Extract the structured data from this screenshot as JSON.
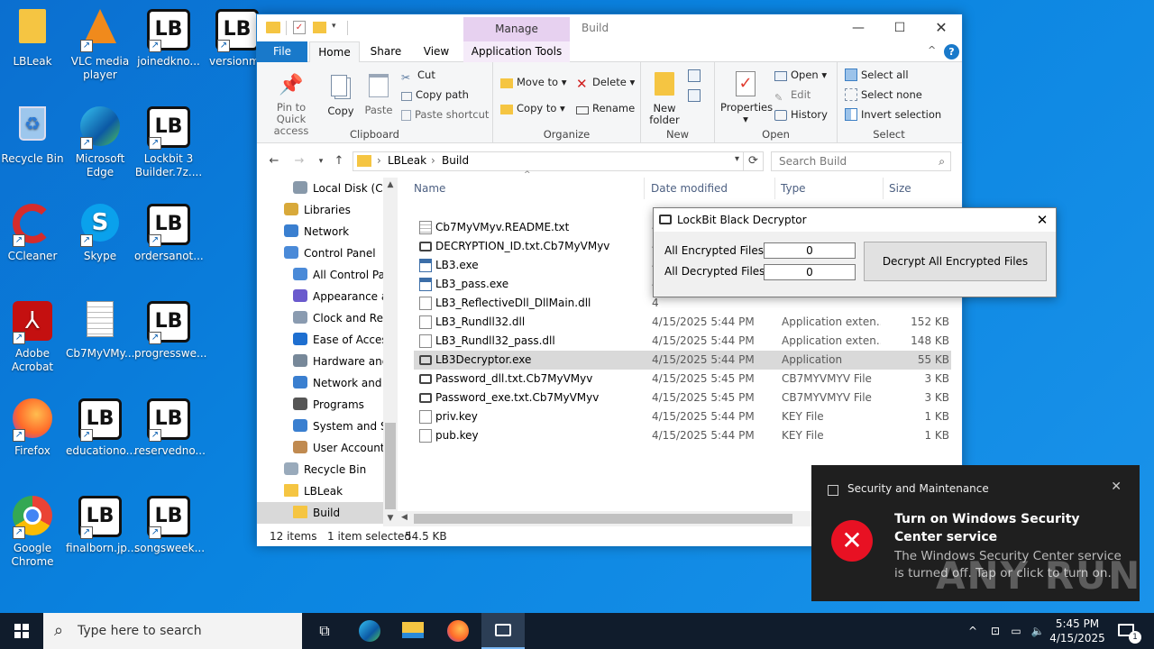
{
  "desktop": {
    "icons": [
      {
        "label": "LBLeak",
        "icon": "folder-icon"
      },
      {
        "label": "VLC media player",
        "icon": "vlc-icon"
      },
      {
        "label": "joinedkno...",
        "icon": "lockbit-icon"
      },
      {
        "label": "versionms",
        "icon": "lockbit-icon"
      },
      {
        "label": "Recycle Bin",
        "icon": "recycle-bin-icon"
      },
      {
        "label": "Microsoft Edge",
        "icon": "edge-icon"
      },
      {
        "label": "Lockbit 3 Builder.7z....",
        "icon": "lockbit-icon"
      },
      {
        "label": "CCleaner",
        "icon": "ccleaner-icon"
      },
      {
        "label": "Skype",
        "icon": "skype-icon"
      },
      {
        "label": "ordersanot...",
        "icon": "lockbit-icon"
      },
      {
        "label": "Adobe Acrobat",
        "icon": "acrobat-icon"
      },
      {
        "label": "Cb7MyVMy...",
        "icon": "text-file-icon"
      },
      {
        "label": "progresswe...",
        "icon": "lockbit-icon"
      },
      {
        "label": "Firefox",
        "icon": "firefox-icon"
      },
      {
        "label": "educationo...",
        "icon": "lockbit-icon"
      },
      {
        "label": "reservedno...",
        "icon": "lockbit-icon"
      },
      {
        "label": "Google Chrome",
        "icon": "chrome-icon"
      },
      {
        "label": "finalborn.jp...",
        "icon": "lockbit-icon"
      },
      {
        "label": "songsweek...",
        "icon": "lockbit-icon"
      }
    ]
  },
  "explorer": {
    "title": "Build",
    "manage_tab": "Manage",
    "tabs": {
      "file": "File",
      "home": "Home",
      "share": "Share",
      "view": "View",
      "app_tools": "Application Tools"
    },
    "ribbon": {
      "clipboard": {
        "label": "Clipboard",
        "pin": "Pin to Quick access",
        "copy": "Copy",
        "paste": "Paste",
        "cut": "Cut",
        "copy_path": "Copy path",
        "paste_shortcut": "Paste shortcut"
      },
      "organize": {
        "label": "Organize",
        "move_to": "Move to",
        "copy_to": "Copy to",
        "delete": "Delete",
        "rename": "Rename"
      },
      "new": {
        "label": "New",
        "new_folder": "New folder"
      },
      "open": {
        "label": "Open",
        "properties": "Properties",
        "open": "Open",
        "edit": "Edit",
        "history": "History"
      },
      "select": {
        "label": "Select",
        "select_all": "Select all",
        "select_none": "Select none",
        "invert": "Invert selection"
      }
    },
    "breadcrumb": [
      "LBLeak",
      "Build"
    ],
    "search_placeholder": "Search Build",
    "nav": [
      {
        "label": "Local Disk (C:)",
        "icon": "drive-icon",
        "indent": 1
      },
      {
        "label": "Libraries",
        "icon": "libraries-icon",
        "indent": 0
      },
      {
        "label": "Network",
        "icon": "network-icon",
        "indent": 0
      },
      {
        "label": "Control Panel",
        "icon": "control-panel-icon",
        "indent": 0
      },
      {
        "label": "All Control Par",
        "icon": "control-panel-icon",
        "indent": 1
      },
      {
        "label": "Appearance an",
        "icon": "appearance-icon",
        "indent": 1
      },
      {
        "label": "Clock and Regi",
        "icon": "clock-icon",
        "indent": 1
      },
      {
        "label": "Ease of Access",
        "icon": "ease-of-access-icon",
        "indent": 1
      },
      {
        "label": "Hardware and",
        "icon": "hardware-icon",
        "indent": 1
      },
      {
        "label": "Network and Ir",
        "icon": "network-icon",
        "indent": 1
      },
      {
        "label": "Programs",
        "icon": "programs-icon",
        "indent": 1
      },
      {
        "label": "System and Se",
        "icon": "security-icon",
        "indent": 1
      },
      {
        "label": "User Accounts",
        "icon": "users-icon",
        "indent": 1
      },
      {
        "label": "Recycle Bin",
        "icon": "recycle-bin-icon",
        "indent": 0
      },
      {
        "label": "LBLeak",
        "icon": "folder-icon",
        "indent": 0
      },
      {
        "label": "Build",
        "icon": "folder-icon",
        "indent": 1
      }
    ],
    "columns": {
      "name": "Name",
      "date": "Date modified",
      "type": "Type",
      "size": "Size"
    },
    "files": [
      {
        "name": "Cb7MyVMyv.README.txt",
        "date": "4",
        "type": "",
        "size": "",
        "icon": "text-file-icon"
      },
      {
        "name": "DECRYPTION_ID.txt.Cb7MyVMyv",
        "date": "4",
        "type": "",
        "size": "",
        "icon": "app-icon"
      },
      {
        "name": "LB3.exe",
        "date": "4",
        "type": "",
        "size": "",
        "icon": "exe-icon"
      },
      {
        "name": "LB3_pass.exe",
        "date": "4",
        "type": "",
        "size": "",
        "icon": "exe-icon"
      },
      {
        "name": "LB3_ReflectiveDll_DllMain.dll",
        "date": "4",
        "type": "",
        "size": "",
        "icon": "dll-icon"
      },
      {
        "name": "LB3_Rundll32.dll",
        "date": "4/15/2025 5:44 PM",
        "type": "Application exten...",
        "size": "152 KB",
        "icon": "dll-icon"
      },
      {
        "name": "LB3_Rundll32_pass.dll",
        "date": "4/15/2025 5:44 PM",
        "type": "Application exten...",
        "size": "148 KB",
        "icon": "dll-icon"
      },
      {
        "name": "LB3Decryptor.exe",
        "date": "4/15/2025 5:44 PM",
        "type": "Application",
        "size": "55 KB",
        "icon": "app-icon"
      },
      {
        "name": "Password_dll.txt.Cb7MyVMyv",
        "date": "4/15/2025 5:45 PM",
        "type": "CB7MYVMYV File",
        "size": "3 KB",
        "icon": "app-icon"
      },
      {
        "name": "Password_exe.txt.Cb7MyVMyv",
        "date": "4/15/2025 5:45 PM",
        "type": "CB7MYVMYV File",
        "size": "3 KB",
        "icon": "app-icon"
      },
      {
        "name": "priv.key",
        "date": "4/15/2025 5:44 PM",
        "type": "KEY File",
        "size": "1 KB",
        "icon": "blank-file-icon"
      },
      {
        "name": "pub.key",
        "date": "4/15/2025 5:44 PM",
        "type": "KEY File",
        "size": "1 KB",
        "icon": "blank-file-icon"
      }
    ],
    "selected_index": 7,
    "status": {
      "items": "12 items",
      "selected": "1 item selected",
      "size": "54.5 KB"
    }
  },
  "dialog": {
    "title": "LockBit Black Decryptor",
    "enc_label": "All Encrypted Files",
    "enc_value": "0",
    "dec_label": "All Decrypted Files",
    "dec_value": "0",
    "button": "Decrypt All Encrypted Files"
  },
  "toast": {
    "source": "Security and Maintenance",
    "title": "Turn on Windows Security Center service",
    "body": "The Windows Security Center service is turned off. Tap or click to turn on."
  },
  "watermark": "ANY RUN",
  "taskbar": {
    "search_placeholder": "Type here to search",
    "time": "5:45 PM",
    "date": "4/15/2025",
    "notification_count": "1"
  }
}
